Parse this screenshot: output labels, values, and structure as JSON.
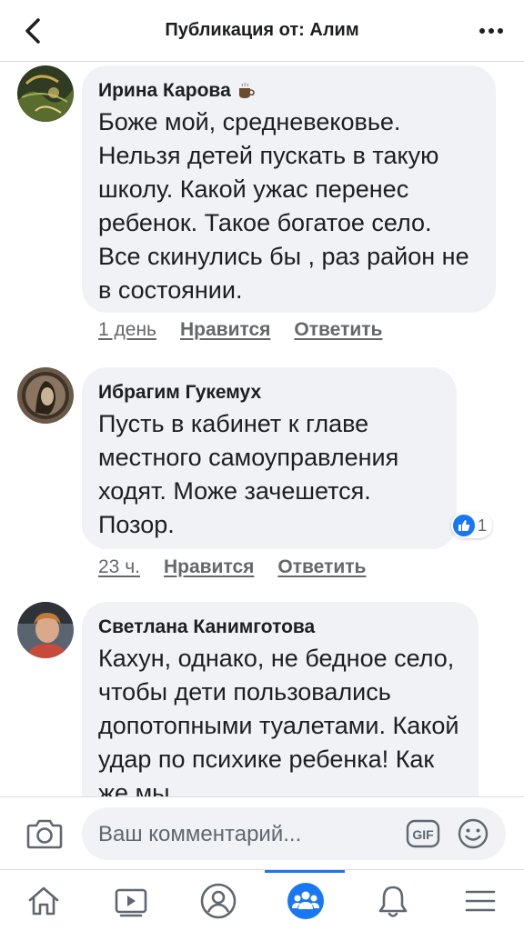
{
  "header": {
    "title": "Публикация от: Алим",
    "back_icon": "chevron-left-icon",
    "more_icon": "more-horizontal-icon"
  },
  "comments": [
    {
      "author": "Ирина Карова",
      "author_badge_icon": "coffee-cup-icon",
      "text": "Боже мой, средневековье. Нельзя детей пускать в такую школу. Какой ужас перенес ребенок. Такое богатое село. Все скинулись бы , раз район не в состоянии.",
      "time": "1 день",
      "like_label": "Нравится",
      "reply_label": "Ответить"
    },
    {
      "author": "Ибрагим Гукемух",
      "text": "Пусть в кабинет к главе местного самоуправления ходят. Може зачешется. Позор.",
      "time": "23 ч.",
      "like_label": "Нравится",
      "reply_label": "Ответить",
      "reactions": "1"
    },
    {
      "author": "Светлана Канимготова",
      "text": "Кахун, однако, не бедное село, чтобы дети пользовались допотопными туалетами. Какой удар по психике ребенка! Как же мы"
    }
  ],
  "composer": {
    "placeholder": "Ваш комментарий...",
    "camera_icon": "camera-icon",
    "gif_label": "GIF",
    "emoji_icon": "emoji-icon"
  },
  "bottom_nav": [
    {
      "icon": "home-icon"
    },
    {
      "icon": "video-icon"
    },
    {
      "icon": "profile-icon"
    },
    {
      "icon": "groups-icon",
      "active": true
    },
    {
      "icon": "bell-icon"
    },
    {
      "icon": "menu-icon"
    }
  ],
  "colors": {
    "accent": "#1877f2",
    "bubble": "#f0f2f5",
    "text": "#1c1e21",
    "secondary": "#65676b"
  }
}
